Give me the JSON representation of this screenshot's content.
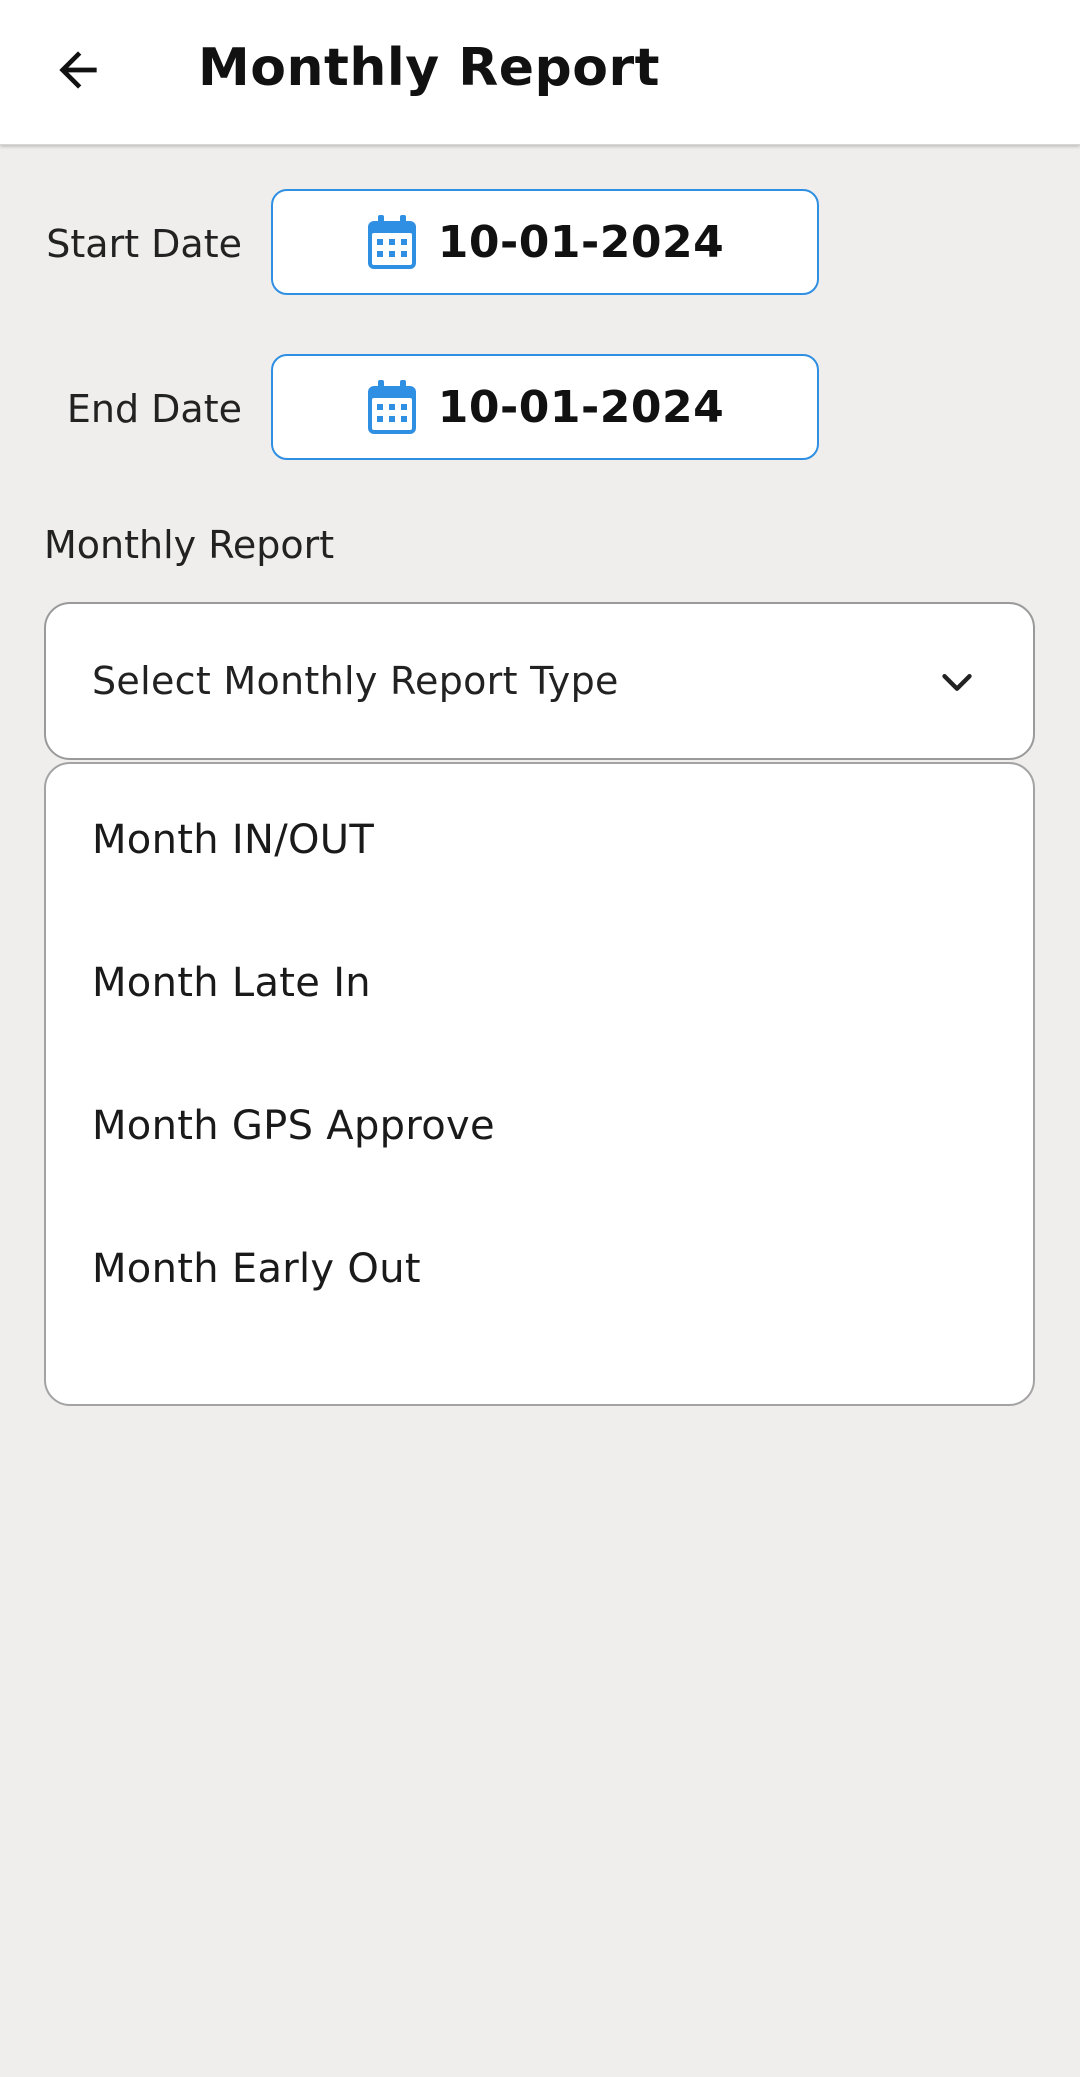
{
  "header": {
    "title": "Monthly Report",
    "back_icon": "arrow-left-icon"
  },
  "filters": {
    "start_label": "Start Date",
    "start_value": "10-01-2024",
    "end_label": "End Date",
    "end_value": "10-01-2024",
    "date_icon": "calendar-icon",
    "accent_color": "#2f8fe3"
  },
  "report": {
    "section_label": "Monthly Report",
    "select_placeholder": "Select Monthly Report Type",
    "dropdown_icon": "chevron-down-icon",
    "options": [
      {
        "label": "Month IN/OUT"
      },
      {
        "label": "Month Late In"
      },
      {
        "label": "Month GPS Approve"
      },
      {
        "label": "Month Early Out"
      }
    ]
  }
}
